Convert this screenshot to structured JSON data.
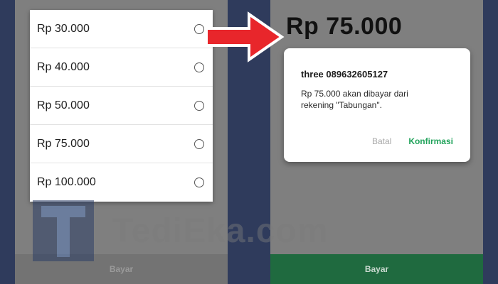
{
  "left_screen": {
    "options": [
      {
        "label": "Rp 30.000"
      },
      {
        "label": "Rp 40.000"
      },
      {
        "label": "Rp 50.000"
      },
      {
        "label": "Rp 75.000"
      },
      {
        "label": "Rp 100.000"
      }
    ],
    "pay_button_label": "Bayar"
  },
  "right_screen": {
    "amount": "Rp 75.000",
    "dialog": {
      "title": "three 089632605127",
      "message": "Rp 75.000 akan dibayar dari rekening \"Tabungan\".",
      "cancel_label": "Batal",
      "confirm_label": "Konfirmasi"
    },
    "pay_button_label": "Bayar"
  },
  "watermark": {
    "text": "TediEka.com",
    "logo_letter": "T"
  },
  "colors": {
    "accent_green": "#21a35b",
    "footer_green": "#1f6a3f",
    "arrow_red": "#e8262b"
  },
  "icons": {
    "arrow": "arrow-right-icon",
    "radio": "radio-unchecked-icon"
  }
}
